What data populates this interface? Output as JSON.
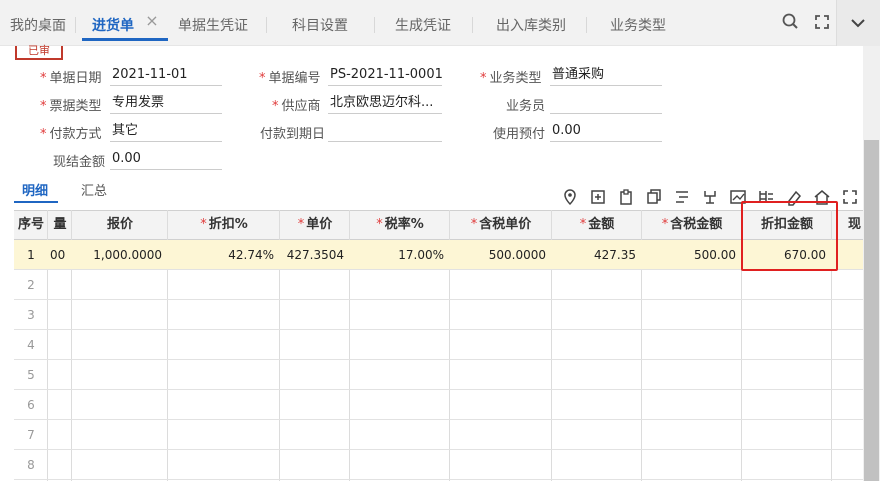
{
  "tabs": [
    {
      "label": "我的桌面"
    },
    {
      "label": "进货单"
    },
    {
      "label": "单据生凭证"
    },
    {
      "label": "科目设置"
    },
    {
      "label": "生成凭证"
    },
    {
      "label": "出入库类别"
    },
    {
      "label": "业务类型"
    }
  ],
  "stamp": "已审",
  "form": {
    "date_label": "单据日期",
    "date_value": "2021-11-01",
    "no_label": "单据编号",
    "no_value": "PS-2021-11-0001",
    "biztype_label": "业务类型",
    "biztype_value": "普通采购",
    "invtype_label": "票据类型",
    "invtype_value": "专用发票",
    "supplier_label": "供应商",
    "supplier_value": "北京欧思迈尔科...",
    "clerk_label": "业务员",
    "clerk_value": "",
    "paymethod_label": "付款方式",
    "paymethod_value": "其它",
    "duedate_label": "付款到期日",
    "duedate_value": "",
    "prepay_label": "使用预付",
    "prepay_value": "0.00",
    "cashamt_label": "现结金额",
    "cashamt_value": "0.00"
  },
  "subtabs": [
    {
      "label": "明细"
    },
    {
      "label": "汇总"
    }
  ],
  "grid": {
    "headers": [
      "序号",
      "量",
      "报价",
      "折扣%",
      "单价",
      "税率%",
      "含税单价",
      "金额",
      "含税金额",
      "折扣金额",
      "现"
    ],
    "required": [
      false,
      false,
      false,
      true,
      true,
      true,
      true,
      true,
      true,
      false,
      false
    ],
    "row1": [
      "1",
      "00",
      "1,000.0000",
      "42.74%",
      "427.3504",
      "17.00%",
      "500.0000",
      "427.35",
      "500.00",
      "670.00",
      ""
    ],
    "empty_rows": [
      "2",
      "3",
      "4",
      "5",
      "6",
      "7",
      "8"
    ]
  },
  "colors": {
    "accent": "#1f66c2",
    "required": "#e03a3a",
    "highlight_row": "#fdf6d5",
    "callout": "#e02020"
  }
}
